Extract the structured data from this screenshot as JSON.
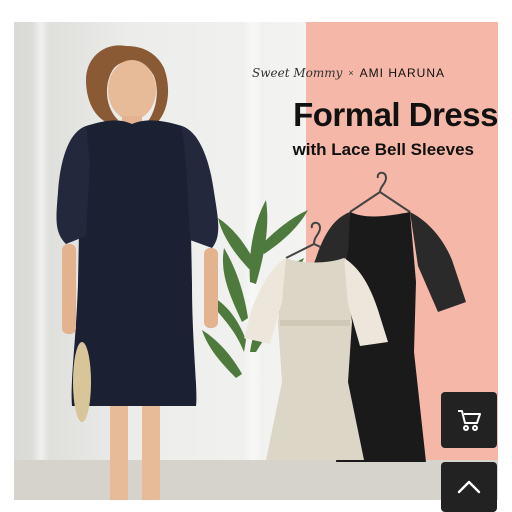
{
  "banner": {
    "brand_script": "Sweet Mommy",
    "brand_separator": "×",
    "brand_collab": "AMI HARUNA",
    "title": "Formal Dress",
    "subtitle": "with Lace Bell Sleeves"
  },
  "colors": {
    "accent_panel": "#f5b7a7",
    "navy_dress": "#1c2033",
    "beige_dress": "#dcd6c7",
    "black_dress": "#1a1a1a",
    "button_bg": "#222222"
  },
  "buttons": {
    "cart_icon": "cart-icon",
    "top_icon": "chevron-up-icon"
  }
}
